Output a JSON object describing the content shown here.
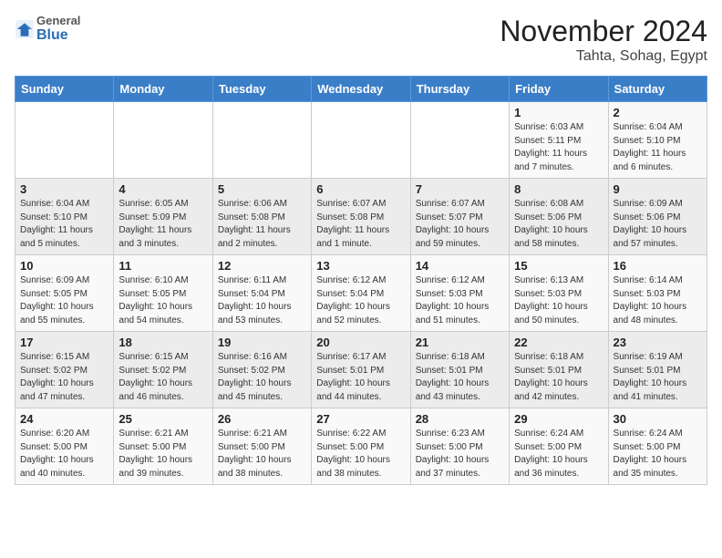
{
  "logo": {
    "general": "General",
    "blue": "Blue"
  },
  "header": {
    "month": "November 2024",
    "location": "Tahta, Sohag, Egypt"
  },
  "weekdays": [
    "Sunday",
    "Monday",
    "Tuesday",
    "Wednesday",
    "Thursday",
    "Friday",
    "Saturday"
  ],
  "weeks": [
    [
      {
        "day": "",
        "info": ""
      },
      {
        "day": "",
        "info": ""
      },
      {
        "day": "",
        "info": ""
      },
      {
        "day": "",
        "info": ""
      },
      {
        "day": "",
        "info": ""
      },
      {
        "day": "1",
        "info": "Sunrise: 6:03 AM\nSunset: 5:11 PM\nDaylight: 11 hours and 7 minutes."
      },
      {
        "day": "2",
        "info": "Sunrise: 6:04 AM\nSunset: 5:10 PM\nDaylight: 11 hours and 6 minutes."
      }
    ],
    [
      {
        "day": "3",
        "info": "Sunrise: 6:04 AM\nSunset: 5:10 PM\nDaylight: 11 hours and 5 minutes."
      },
      {
        "day": "4",
        "info": "Sunrise: 6:05 AM\nSunset: 5:09 PM\nDaylight: 11 hours and 3 minutes."
      },
      {
        "day": "5",
        "info": "Sunrise: 6:06 AM\nSunset: 5:08 PM\nDaylight: 11 hours and 2 minutes."
      },
      {
        "day": "6",
        "info": "Sunrise: 6:07 AM\nSunset: 5:08 PM\nDaylight: 11 hours and 1 minute."
      },
      {
        "day": "7",
        "info": "Sunrise: 6:07 AM\nSunset: 5:07 PM\nDaylight: 10 hours and 59 minutes."
      },
      {
        "day": "8",
        "info": "Sunrise: 6:08 AM\nSunset: 5:06 PM\nDaylight: 10 hours and 58 minutes."
      },
      {
        "day": "9",
        "info": "Sunrise: 6:09 AM\nSunset: 5:06 PM\nDaylight: 10 hours and 57 minutes."
      }
    ],
    [
      {
        "day": "10",
        "info": "Sunrise: 6:09 AM\nSunset: 5:05 PM\nDaylight: 10 hours and 55 minutes."
      },
      {
        "day": "11",
        "info": "Sunrise: 6:10 AM\nSunset: 5:05 PM\nDaylight: 10 hours and 54 minutes."
      },
      {
        "day": "12",
        "info": "Sunrise: 6:11 AM\nSunset: 5:04 PM\nDaylight: 10 hours and 53 minutes."
      },
      {
        "day": "13",
        "info": "Sunrise: 6:12 AM\nSunset: 5:04 PM\nDaylight: 10 hours and 52 minutes."
      },
      {
        "day": "14",
        "info": "Sunrise: 6:12 AM\nSunset: 5:03 PM\nDaylight: 10 hours and 51 minutes."
      },
      {
        "day": "15",
        "info": "Sunrise: 6:13 AM\nSunset: 5:03 PM\nDaylight: 10 hours and 50 minutes."
      },
      {
        "day": "16",
        "info": "Sunrise: 6:14 AM\nSunset: 5:03 PM\nDaylight: 10 hours and 48 minutes."
      }
    ],
    [
      {
        "day": "17",
        "info": "Sunrise: 6:15 AM\nSunset: 5:02 PM\nDaylight: 10 hours and 47 minutes."
      },
      {
        "day": "18",
        "info": "Sunrise: 6:15 AM\nSunset: 5:02 PM\nDaylight: 10 hours and 46 minutes."
      },
      {
        "day": "19",
        "info": "Sunrise: 6:16 AM\nSunset: 5:02 PM\nDaylight: 10 hours and 45 minutes."
      },
      {
        "day": "20",
        "info": "Sunrise: 6:17 AM\nSunset: 5:01 PM\nDaylight: 10 hours and 44 minutes."
      },
      {
        "day": "21",
        "info": "Sunrise: 6:18 AM\nSunset: 5:01 PM\nDaylight: 10 hours and 43 minutes."
      },
      {
        "day": "22",
        "info": "Sunrise: 6:18 AM\nSunset: 5:01 PM\nDaylight: 10 hours and 42 minutes."
      },
      {
        "day": "23",
        "info": "Sunrise: 6:19 AM\nSunset: 5:01 PM\nDaylight: 10 hours and 41 minutes."
      }
    ],
    [
      {
        "day": "24",
        "info": "Sunrise: 6:20 AM\nSunset: 5:00 PM\nDaylight: 10 hours and 40 minutes."
      },
      {
        "day": "25",
        "info": "Sunrise: 6:21 AM\nSunset: 5:00 PM\nDaylight: 10 hours and 39 minutes."
      },
      {
        "day": "26",
        "info": "Sunrise: 6:21 AM\nSunset: 5:00 PM\nDaylight: 10 hours and 38 minutes."
      },
      {
        "day": "27",
        "info": "Sunrise: 6:22 AM\nSunset: 5:00 PM\nDaylight: 10 hours and 38 minutes."
      },
      {
        "day": "28",
        "info": "Sunrise: 6:23 AM\nSunset: 5:00 PM\nDaylight: 10 hours and 37 minutes."
      },
      {
        "day": "29",
        "info": "Sunrise: 6:24 AM\nSunset: 5:00 PM\nDaylight: 10 hours and 36 minutes."
      },
      {
        "day": "30",
        "info": "Sunrise: 6:24 AM\nSunset: 5:00 PM\nDaylight: 10 hours and 35 minutes."
      }
    ]
  ]
}
